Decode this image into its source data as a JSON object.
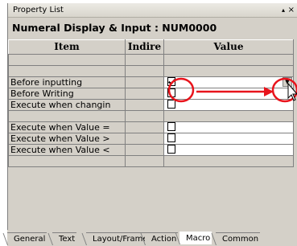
{
  "window": {
    "title": "Property List",
    "pin_glyph": "▴",
    "close_glyph": "×"
  },
  "object_header": "Numeral Display & Input : NUM0000",
  "columns": {
    "item": "Item",
    "indirect": "Indire",
    "value": "Value"
  },
  "rows": [
    {
      "label": "",
      "checkbox": false,
      "checked": false
    },
    {
      "label": "",
      "checkbox": false,
      "checked": false
    },
    {
      "label": "Before inputting",
      "checkbox": true,
      "checked": true,
      "dropdown": true
    },
    {
      "label": "Before Writing",
      "checkbox": true,
      "checked": false
    },
    {
      "label": "Execute when changin",
      "checkbox": true,
      "checked": false
    },
    {
      "label": "",
      "checkbox": false,
      "checked": false
    },
    {
      "label": "Execute when Value =",
      "checkbox": true,
      "checked": false
    },
    {
      "label": "Execute when Value >",
      "checkbox": true,
      "checked": false
    },
    {
      "label": "Execute when Value <",
      "checkbox": true,
      "checked": false
    },
    {
      "label": "",
      "checkbox": false,
      "checked": false
    }
  ],
  "tabs": [
    {
      "label": "General",
      "active": false
    },
    {
      "label": "Text",
      "active": false
    },
    {
      "label": "Layout/Frame",
      "active": false
    },
    {
      "label": "Action",
      "active": false
    },
    {
      "label": "Macro",
      "active": true
    },
    {
      "label": "Common",
      "active": false
    }
  ],
  "annotation_color": "#e8141c"
}
